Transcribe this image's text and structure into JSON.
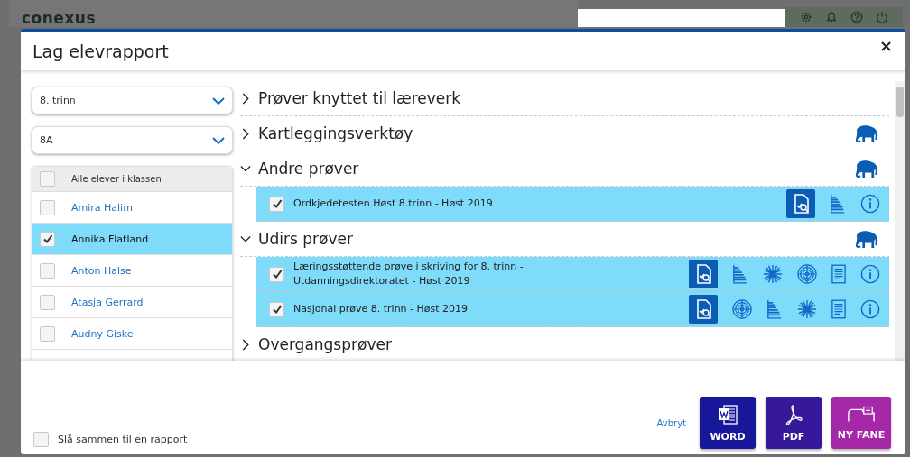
{
  "app": {
    "logo": "conexus"
  },
  "dialog": {
    "title": "Lag elevrapport",
    "close": "×"
  },
  "filters": [
    {
      "value": "8. trinn"
    },
    {
      "value": "8A"
    }
  ],
  "students": {
    "all": {
      "label": "Alle elever i klassen",
      "checked": false
    },
    "items": [
      {
        "name": "Amira Halim",
        "checked": false
      },
      {
        "name": "Annika Flatland",
        "checked": true
      },
      {
        "name": "Anton Halse",
        "checked": false
      },
      {
        "name": "Atasja Gerrard",
        "checked": false
      },
      {
        "name": "Audny Giske",
        "checked": false
      }
    ]
  },
  "sections": [
    {
      "title": "Prøver knyttet til læreverk",
      "expanded": false,
      "logo": false
    },
    {
      "title": "Kartleggingsverktøy",
      "expanded": false,
      "logo": true
    },
    {
      "title": "Andre prøver",
      "expanded": true,
      "logo": true,
      "tests": [
        {
          "title": "Ordkjedetesten Høst 8.trinn - Høst 2019",
          "checked": true,
          "actions": [
            {
              "kind": "report"
            },
            {
              "kind": "bars"
            },
            {
              "kind": "info"
            }
          ]
        }
      ]
    },
    {
      "title": "Udirs prøver",
      "expanded": true,
      "logo": true,
      "tests": [
        {
          "title": "Læringsstøttende prøve i skriving for 8. trinn - Utdanningsdirektoratet - Høst 2019",
          "checked": true,
          "actions": [
            {
              "kind": "report"
            },
            {
              "kind": "bars"
            },
            {
              "kind": "burst"
            },
            {
              "kind": "target"
            },
            {
              "kind": "document"
            },
            {
              "kind": "info"
            }
          ]
        },
        {
          "title": "Nasjonal prøve 8. trinn - Høst 2019",
          "checked": true,
          "actions": [
            {
              "kind": "report"
            },
            {
              "kind": "target"
            },
            {
              "kind": "bars"
            },
            {
              "kind": "burst"
            },
            {
              "kind": "document"
            },
            {
              "kind": "info"
            }
          ]
        }
      ]
    },
    {
      "title": "Overgangsprøver",
      "expanded": false,
      "logo": false
    }
  ],
  "footer": {
    "merge": {
      "label": "Slå sammen til en rapport",
      "checked": false
    },
    "cancel": "Avbryt",
    "buttons": [
      {
        "label": "WORD",
        "kind": "word"
      },
      {
        "label": "PDF",
        "kind": "pdf"
      },
      {
        "label": "NY FANE",
        "kind": "tab"
      }
    ]
  }
}
